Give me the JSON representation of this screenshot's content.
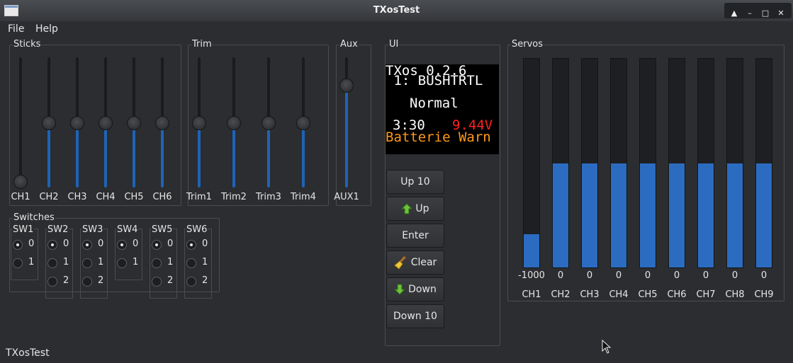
{
  "window": {
    "title": "TXosTest"
  },
  "menu": [
    {
      "label": "File"
    },
    {
      "label": "Help"
    }
  ],
  "sticks": {
    "title": "Sticks",
    "channels": [
      {
        "label": "CH1",
        "level": 0.0
      },
      {
        "label": "CH2",
        "level": 0.5
      },
      {
        "label": "CH3",
        "level": 0.5
      },
      {
        "label": "CH4",
        "level": 0.5
      },
      {
        "label": "CH5",
        "level": 0.5
      },
      {
        "label": "CH6",
        "level": 0.5
      }
    ]
  },
  "trim": {
    "title": "Trim",
    "channels": [
      {
        "label": "Trim1",
        "level": 0.5
      },
      {
        "label": "Trim2",
        "level": 0.5
      },
      {
        "label": "Trim3",
        "level": 0.5
      },
      {
        "label": "Trim4",
        "level": 0.5
      }
    ]
  },
  "aux": {
    "title": "Aux",
    "channels": [
      {
        "label": "AUX1",
        "level": 0.82
      }
    ]
  },
  "switches": {
    "title": "Switches",
    "items": [
      {
        "label": "SW1",
        "options": [
          "0",
          "1"
        ],
        "selected": 0
      },
      {
        "label": "SW2",
        "options": [
          "0",
          "1",
          "2"
        ],
        "selected": 0
      },
      {
        "label": "SW3",
        "options": [
          "0",
          "1",
          "2"
        ],
        "selected": 0
      },
      {
        "label": "SW4",
        "options": [
          "0",
          "1"
        ],
        "selected": 0
      },
      {
        "label": "SW5",
        "options": [
          "0",
          "1",
          "2"
        ],
        "selected": 0
      },
      {
        "label": "SW6",
        "options": [
          "0",
          "1",
          "2"
        ],
        "selected": 0
      }
    ]
  },
  "ui": {
    "title": "UI",
    "lcd": {
      "line1": "TXos 0.2.6",
      "line2": " 1: BUSHTRTL",
      "line3": "Normal",
      "time": "3:30",
      "voltage": "9.44V",
      "warning": "Batterie Warn",
      "colors": {
        "text": "#ffffff",
        "voltage": "#ff2020",
        "warning": "#ff9a1a"
      }
    },
    "buttons": [
      {
        "label": "Up 10",
        "icon": ""
      },
      {
        "label": "Up",
        "icon": "up-arrow-icon"
      },
      {
        "label": "Enter",
        "icon": ""
      },
      {
        "label": "Clear",
        "icon": "broom-icon"
      },
      {
        "label": "Down",
        "icon": "down-arrow-icon"
      },
      {
        "label": "Down 10",
        "icon": ""
      }
    ]
  },
  "servos": {
    "title": "Servos",
    "channels": [
      {
        "label": "CH1",
        "value": "-1000",
        "level": 0.16
      },
      {
        "label": "CH2",
        "value": "0",
        "level": 0.5
      },
      {
        "label": "CH3",
        "value": "0",
        "level": 0.5
      },
      {
        "label": "CH4",
        "value": "0",
        "level": 0.5
      },
      {
        "label": "CH5",
        "value": "0",
        "level": 0.5
      },
      {
        "label": "CH6",
        "value": "0",
        "level": 0.5
      },
      {
        "label": "CH7",
        "value": "0",
        "level": 0.5
      },
      {
        "label": "CH8",
        "value": "0",
        "level": 0.5
      },
      {
        "label": "CH9",
        "value": "0",
        "level": 0.5
      }
    ]
  },
  "statusbar": {
    "text": "TXosTest"
  },
  "colors": {
    "accent": "#1f63b6",
    "servo_fill": "#2b6cc0",
    "background": "#2b2d30"
  }
}
